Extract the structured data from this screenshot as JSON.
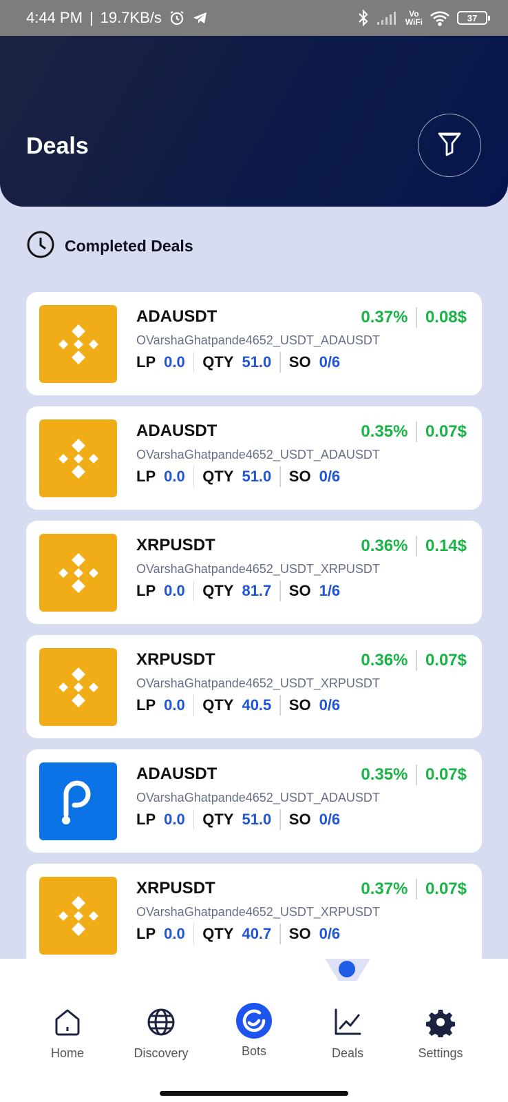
{
  "status_bar": {
    "time": "4:44 PM",
    "speed": "19.7KB/s",
    "network_label_top": "Vo",
    "network_label_bottom": "WiFi",
    "battery": "37",
    "icons": [
      "alarm-icon",
      "telegram-icon",
      "bluetooth-icon",
      "signal-icon",
      "wifi-icon",
      "battery-icon"
    ]
  },
  "header": {
    "title": "Deals",
    "filter_icon": "filter-icon"
  },
  "section": {
    "title": "Completed Deals",
    "icon": "clock-icon"
  },
  "labels": {
    "lp": "LP",
    "qty": "QTY",
    "so": "SO"
  },
  "colors": {
    "header_bg": "#0e1b48",
    "page_bg": "#d8dcf1",
    "profit_green": "#19b445",
    "value_blue": "#1f55d6",
    "binance_yellow": "#f0ad17",
    "polkadot_blue": "#0c73e6"
  },
  "deals": [
    {
      "pair": "ADAUSDT",
      "percent": "0.37%",
      "profit": "0.08$",
      "bot": "OVarshaGhatpande4652_USDT_ADAUSDT",
      "lp": "0.0",
      "qty": "51.0",
      "so": "0/6",
      "exchange_icon": "binance-logo-icon"
    },
    {
      "pair": "ADAUSDT",
      "percent": "0.35%",
      "profit": "0.07$",
      "bot": "OVarshaGhatpande4652_USDT_ADAUSDT",
      "lp": "0.0",
      "qty": "51.0",
      "so": "0/6",
      "exchange_icon": "binance-logo-icon"
    },
    {
      "pair": "XRPUSDT",
      "percent": "0.36%",
      "profit": "0.14$",
      "bot": "OVarshaGhatpande4652_USDT_XRPUSDT",
      "lp": "0.0",
      "qty": "81.7",
      "so": "1/6",
      "exchange_icon": "binance-logo-icon"
    },
    {
      "pair": "XRPUSDT",
      "percent": "0.36%",
      "profit": "0.07$",
      "bot": "OVarshaGhatpande4652_USDT_XRPUSDT",
      "lp": "0.0",
      "qty": "40.5",
      "so": "0/6",
      "exchange_icon": "binance-logo-icon"
    },
    {
      "pair": "ADAUSDT",
      "percent": "0.35%",
      "profit": "0.07$",
      "bot": "OVarshaGhatpande4652_USDT_ADAUSDT",
      "lp": "0.0",
      "qty": "51.0",
      "so": "0/6",
      "exchange_icon": "polkadot-logo-icon"
    },
    {
      "pair": "XRPUSDT",
      "percent": "0.37%",
      "profit": "0.07$",
      "bot": "OVarshaGhatpande4652_USDT_XRPUSDT",
      "lp": "0.0",
      "qty": "40.7",
      "so": "0/6",
      "exchange_icon": "binance-logo-icon"
    }
  ],
  "nav": {
    "items": [
      {
        "label": "Home",
        "icon": "home-icon"
      },
      {
        "label": "Discovery",
        "icon": "globe-icon"
      },
      {
        "label": "Bots",
        "icon": "bots-icon"
      },
      {
        "label": "Deals",
        "icon": "chart-line-icon"
      },
      {
        "label": "Settings",
        "icon": "gear-icon"
      }
    ],
    "active": "Deals"
  }
}
